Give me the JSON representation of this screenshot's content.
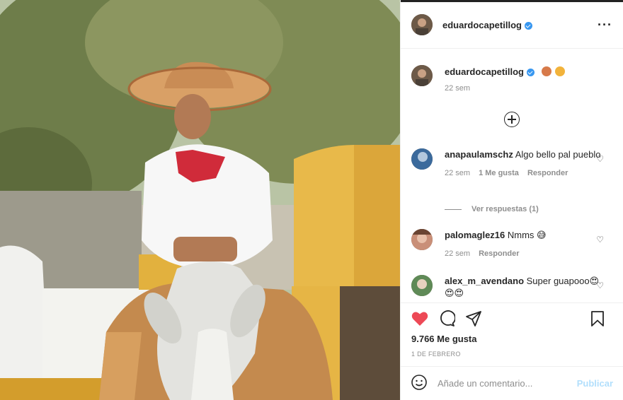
{
  "post": {
    "author": "eduardocapetillog",
    "author_verified": true,
    "more_icon": "more-icon"
  },
  "caption": {
    "username": "eduardocapetillog",
    "emojis": [
      "woman-emoji",
      "cowboy-emoji"
    ],
    "time": "22 sem"
  },
  "comments": [
    {
      "username": "anapaulamschz",
      "text": "Algo bello pal pueblo",
      "time": "22 sem",
      "likes": "1 Me gusta",
      "reply": "Responder",
      "view_replies": "Ver respuestas (1)"
    },
    {
      "username": "palomaglez16",
      "text": "Nmms 😅",
      "time": "22 sem",
      "reply": "Responder"
    },
    {
      "username": "alex_m_avendano",
      "text": "Super guapooo😍😍😍"
    }
  ],
  "footer": {
    "likes": "9.766 Me gusta",
    "date": "1 DE FEBRERO",
    "comment_placeholder": "Añade un comentario...",
    "publish_label": "Publicar"
  },
  "colors": {
    "verified": "#3897f0",
    "like_red": "#ed4956",
    "publish_disabled": "#b2dffc"
  }
}
